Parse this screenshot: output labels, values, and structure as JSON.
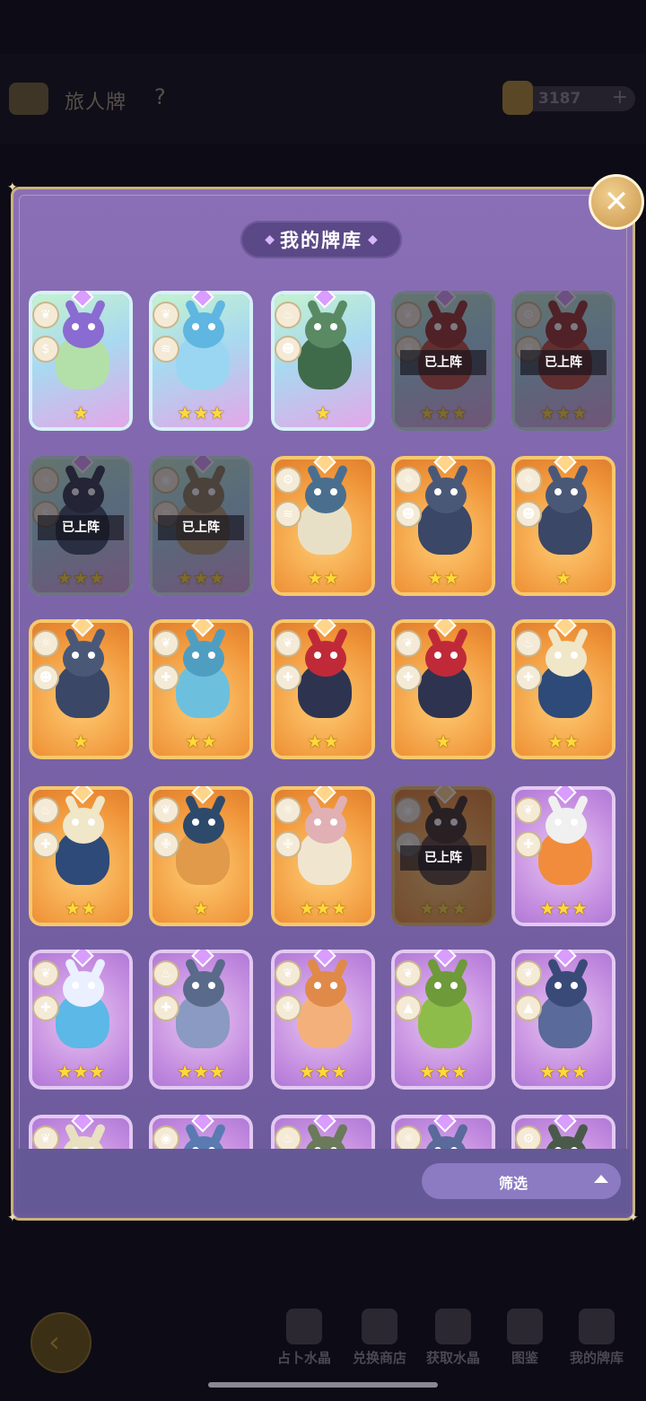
{
  "background_screen": {
    "title": "旅人牌",
    "help": "?",
    "crystal_count": "3187",
    "crystal_plus": "+",
    "nav": [
      {
        "label": "占卜水晶"
      },
      {
        "label": "兑换商店"
      },
      {
        "label": "获取水晶"
      },
      {
        "label": "图鉴"
      },
      {
        "label": "我的牌库"
      }
    ]
  },
  "panel": {
    "title": "我的牌库",
    "close_icon": "close-icon",
    "filter_label": "筛选"
  },
  "cards": [
    {
      "frame": "legend",
      "stars": "★",
      "attr1": "leaf",
      "attr2": "coin",
      "deployed": false,
      "deployed_label": ""
    },
    {
      "frame": "legend",
      "stars": "★★★",
      "attr1": "leaf",
      "attr2": "claw",
      "deployed": false,
      "deployed_label": ""
    },
    {
      "frame": "legend",
      "stars": "★",
      "attr1": "bowl",
      "attr2": "skull",
      "deployed": false,
      "deployed_label": ""
    },
    {
      "frame": "legend",
      "stars": "★★★",
      "attr1": "leaf",
      "attr2": "crown",
      "deployed": true,
      "deployed_label": "已上阵"
    },
    {
      "frame": "legend",
      "stars": "★★★",
      "attr1": "gear",
      "attr2": "crown",
      "deployed": true,
      "deployed_label": "已上阵"
    },
    {
      "frame": "legend",
      "stars": "★★★",
      "attr1": "sun",
      "attr2": "coin",
      "deployed": true,
      "deployed_label": "已上阵"
    },
    {
      "frame": "legend",
      "stars": "★★★",
      "attr1": "egg",
      "attr2": "claw",
      "deployed": true,
      "deployed_label": "已上阵"
    },
    {
      "frame": "orange",
      "stars": "★★",
      "attr1": "gear",
      "attr2": "claw",
      "deployed": false,
      "deployed_label": ""
    },
    {
      "frame": "orange",
      "stars": "★★",
      "attr1": "sun",
      "attr2": "skull",
      "deployed": false,
      "deployed_label": ""
    },
    {
      "frame": "orange",
      "stars": "★",
      "attr1": "sun",
      "attr2": "skull",
      "deployed": false,
      "deployed_label": ""
    },
    {
      "frame": "orange",
      "stars": "★",
      "attr1": "sun",
      "attr2": "skull",
      "deployed": false,
      "deployed_label": ""
    },
    {
      "frame": "orange",
      "stars": "★★",
      "attr1": "leaf",
      "attr2": "puzzle",
      "deployed": false,
      "deployed_label": ""
    },
    {
      "frame": "orange",
      "stars": "★★",
      "attr1": "leaf",
      "attr2": "puzzle",
      "deployed": false,
      "deployed_label": ""
    },
    {
      "frame": "orange",
      "stars": "★",
      "attr1": "leaf",
      "attr2": "puzzle",
      "deployed": false,
      "deployed_label": ""
    },
    {
      "frame": "orange",
      "stars": "★★",
      "attr1": "bowl",
      "attr2": "puzzle",
      "deployed": false,
      "deployed_label": ""
    },
    {
      "frame": "orange",
      "stars": "★★",
      "attr1": "bowl",
      "attr2": "puzzle",
      "deployed": false,
      "deployed_label": ""
    },
    {
      "frame": "orange",
      "stars": "★",
      "attr1": "leaf",
      "attr2": "cross",
      "deployed": false,
      "deployed_label": ""
    },
    {
      "frame": "orange",
      "stars": "★★★",
      "attr1": "sun",
      "attr2": "cross",
      "deployed": false,
      "deployed_label": ""
    },
    {
      "frame": "orange",
      "stars": "★★★",
      "attr1": "egg",
      "attr2": "cross",
      "deployed": true,
      "deployed_label": "已上阵"
    },
    {
      "frame": "purple",
      "stars": "★★★",
      "attr1": "leaf",
      "attr2": "puzzle",
      "deployed": false,
      "deployed_label": ""
    },
    {
      "frame": "purple",
      "stars": "★★★",
      "attr1": "leaf",
      "attr2": "puzzle",
      "deployed": false,
      "deployed_label": ""
    },
    {
      "frame": "purple",
      "stars": "★★★",
      "attr1": "bowl",
      "attr2": "puzzle",
      "deployed": false,
      "deployed_label": ""
    },
    {
      "frame": "purple",
      "stars": "★★★",
      "attr1": "leaf",
      "attr2": "cross",
      "deployed": false,
      "deployed_label": ""
    },
    {
      "frame": "purple",
      "stars": "★★★",
      "attr1": "leaf",
      "attr2": "fire",
      "deployed": false,
      "deployed_label": ""
    },
    {
      "frame": "purple",
      "stars": "★★★",
      "attr1": "leaf",
      "attr2": "fire",
      "deployed": false,
      "deployed_label": ""
    },
    {
      "frame": "purple",
      "stars": "",
      "attr1": "leaf",
      "attr2": "",
      "deployed": false,
      "deployed_label": ""
    },
    {
      "frame": "purple",
      "stars": "",
      "attr1": "egg",
      "attr2": "",
      "deployed": false,
      "deployed_label": ""
    },
    {
      "frame": "purple",
      "stars": "",
      "attr1": "bowl",
      "attr2": "",
      "deployed": false,
      "deployed_label": ""
    },
    {
      "frame": "purple",
      "stars": "",
      "attr1": "sun",
      "attr2": "",
      "deployed": false,
      "deployed_label": ""
    },
    {
      "frame": "purple",
      "stars": "",
      "attr1": "gear",
      "attr2": "",
      "deployed": false,
      "deployed_label": ""
    }
  ]
}
